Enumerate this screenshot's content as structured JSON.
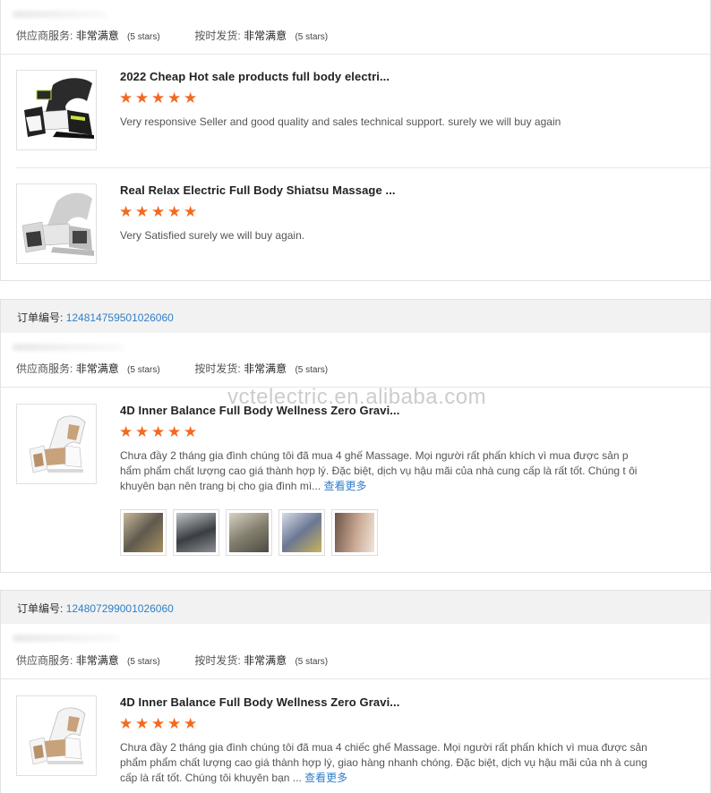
{
  "labels": {
    "supplier_service": "供应商服务:",
    "on_time_delivery": "按时发货:",
    "very_satisfied": "非常满意",
    "five_stars": "(5 stars)",
    "order_no": "订单编号:",
    "see_more": "查看更多"
  },
  "watermark": "vctelectric.en.alibaba.com",
  "orders": [
    {
      "items": [
        {
          "title": "2022 Cheap Hot sale products full body electri...",
          "rating": 5,
          "review": "Very responsive Seller and good quality and sales technical support. surely we will buy again"
        },
        {
          "title": "Real Relax Electric Full Body Shiatsu Massage ...",
          "rating": 5,
          "review": "Very Satisfied surely we will buy again."
        }
      ]
    },
    {
      "order_number": "124814759501026060",
      "items": [
        {
          "title": "4D Inner Balance Full Body Wellness Zero Gravi...",
          "rating": 5,
          "review": "Chưa đầy 2 tháng gia đình chúng tôi đã mua 4 ghế Massage. Mọi người rất phấn khích vì mua được sản p hẩm phẩm chất lượng cao giá thành hợp lý. Đặc biệt, dịch vụ hậu mãi của nhà cung cấp là rất tốt. Chúng t ôi khuyên bạn nên trang bị cho gia đình mì...",
          "photo_count": 5
        }
      ]
    },
    {
      "order_number": "124807299001026060",
      "items": [
        {
          "title": "4D Inner Balance Full Body Wellness Zero Gravi...",
          "rating": 5,
          "review": "Chưa đầy 2 tháng gia đình chúng tôi đã mua 4 chiếc ghế Massage. Mọi người rất phấn khích vì mua được sản phẩm phẩm chất lượng cao giá thành hợp lý, giao hàng nhanh chóng. Đặc biệt, dịch vụ hậu mãi của nh à cung cấp là rất tốt. Chúng tôi khuyên bạn ..."
        }
      ]
    }
  ],
  "colors": {
    "star": "#f26a21",
    "link": "#2f7fc7",
    "header_bg": "#f2f2f2"
  }
}
